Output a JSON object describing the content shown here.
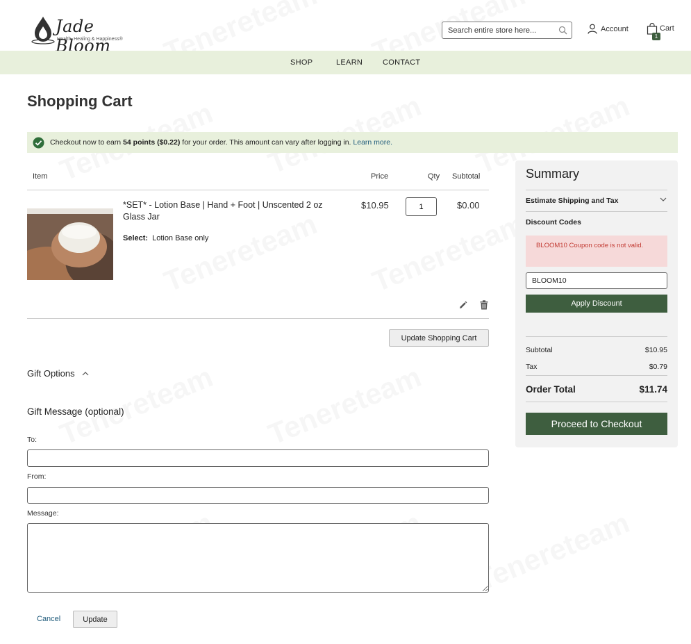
{
  "header": {
    "logo_name": "Jade Bloom",
    "logo_tagline": "Health, Healing & Happiness®",
    "search_placeholder": "Search entire store here...",
    "account_label": "Account",
    "cart_label": "Cart",
    "cart_count": "1"
  },
  "nav": {
    "items": [
      "SHOP",
      "LEARN",
      "CONTACT"
    ]
  },
  "page_title": "Shopping Cart",
  "notice": {
    "prefix": "Checkout now to earn ",
    "points": "54 points",
    "amount": "($0.22)",
    "suffix": " for your order. This amount can vary after logging in. ",
    "link": "Learn more."
  },
  "table": {
    "headers": {
      "item": "Item",
      "price": "Price",
      "qty": "Qty",
      "subtotal": "Subtotal"
    },
    "row": {
      "name": "*SET* - Lotion Base | Hand + Foot | Unscented 2 oz Glass Jar",
      "option_label": "Select:",
      "option_value": "Lotion Base only",
      "price": "$10.95",
      "qty": "1",
      "subtotal": "$0.00"
    },
    "update_cart_label": "Update Shopping Cart"
  },
  "gift": {
    "options_label": "Gift Options",
    "message_title": "Gift Message (optional)",
    "to_label": "To:",
    "from_label": "From:",
    "message_label": "Message:",
    "to_value": "",
    "from_value": "",
    "message_value": "",
    "cancel_label": "Cancel",
    "update_label": "Update"
  },
  "summary": {
    "title": "Summary",
    "shipping_label": "Estimate Shipping and Tax",
    "discount_label": "Discount Codes",
    "error": "BLOOM10 Coupon code is not valid.",
    "coupon_value": "BLOOM10",
    "apply_label": "Apply Discount",
    "subtotal_label": "Subtotal",
    "subtotal_value": "$10.95",
    "tax_label": "Tax",
    "tax_value": "$0.79",
    "total_label": "Order Total",
    "total_value": "$11.74",
    "checkout_label": "Proceed to Checkout"
  },
  "watermark": "Tenereteam",
  "colors": {
    "brand_green": "#3e5e3f",
    "nav_bg": "#e8f0dc",
    "error_bg": "#f6d9d9",
    "error_text": "#c23a32",
    "link": "#1e5a7a"
  }
}
